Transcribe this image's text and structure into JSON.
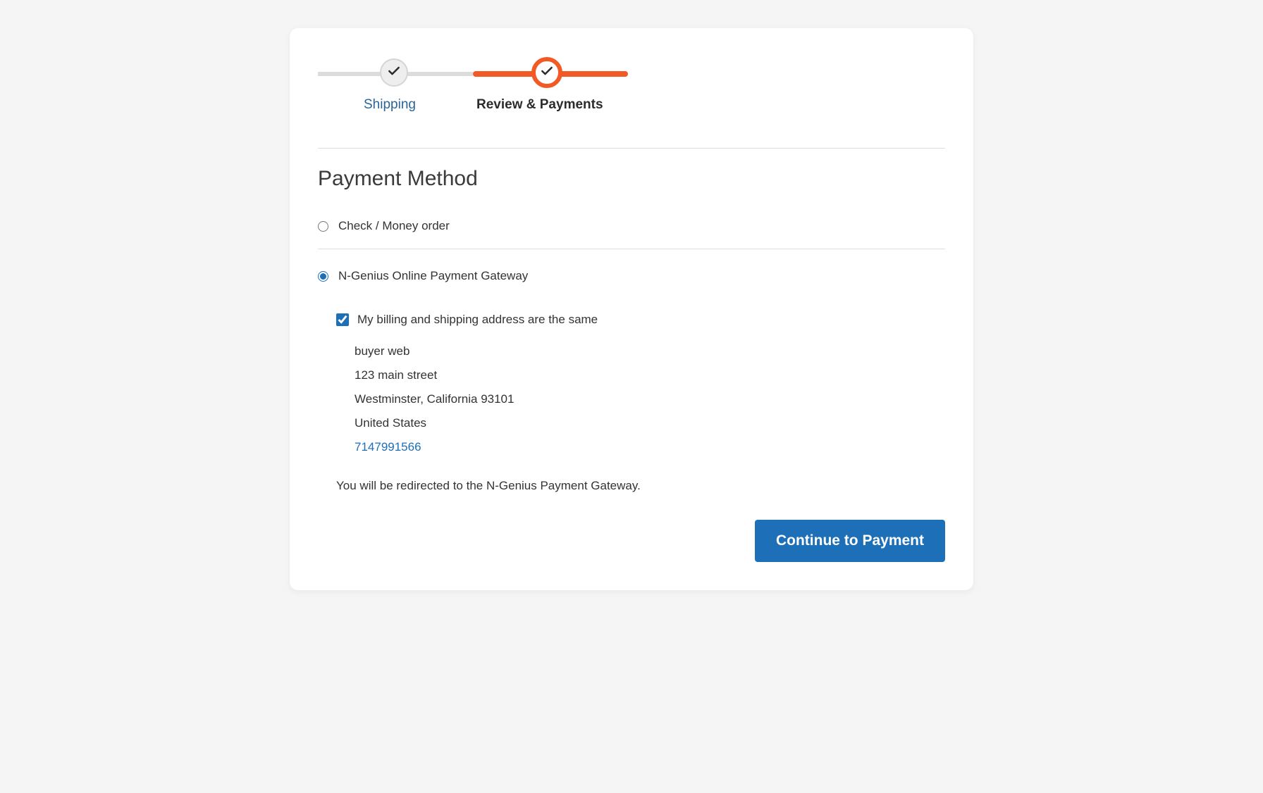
{
  "colors": {
    "accent_orange": "#f15a24",
    "accent_blue": "#1d6fb8",
    "link_blue": "#2a6496"
  },
  "progress": {
    "steps": [
      {
        "label": "Shipping",
        "active": false
      },
      {
        "label": "Review & Payments",
        "active": true
      }
    ]
  },
  "payment": {
    "section_title": "Payment Method",
    "methods": [
      {
        "label": "Check / Money order",
        "selected": false
      },
      {
        "label": "N-Genius Online Payment Gateway",
        "selected": true
      }
    ],
    "billing_same_label": "My billing and shipping address are the same",
    "billing_same_checked": true,
    "address": {
      "name": "buyer web",
      "street": "123 main street",
      "city_region_postal": "Westminster, California 93101",
      "country": "United States",
      "phone": "7147991566"
    },
    "redirect_note": "You will be redirected to the N-Genius Payment Gateway."
  },
  "actions": {
    "continue_label": "Continue to Payment"
  }
}
